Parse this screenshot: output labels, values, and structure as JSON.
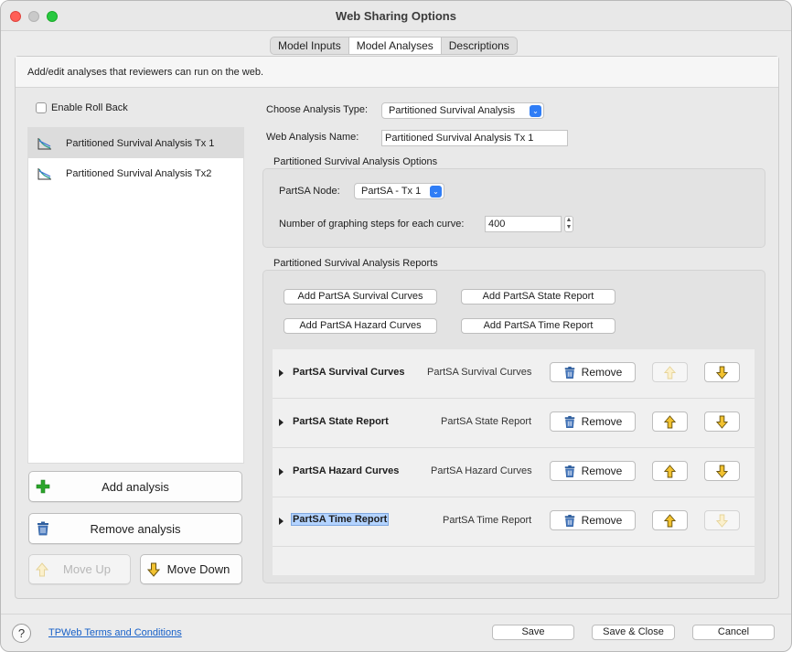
{
  "window": {
    "title": "Web Sharing Options"
  },
  "tabs": [
    {
      "label": "Model Inputs"
    },
    {
      "label": "Model Analyses"
    },
    {
      "label": "Descriptions"
    }
  ],
  "description": "Add/edit analyses that reviewers can run on the web.",
  "left": {
    "enable_rollback_label": "Enable Roll Back",
    "analyses": [
      {
        "label": "Partitioned Survival Analysis Tx 1",
        "icon": "partsa-icon"
      },
      {
        "label": "Partitioned Survival Analysis Tx2",
        "icon": "partsa-icon"
      }
    ],
    "add_label": "Add analysis",
    "remove_label": "Remove analysis",
    "move_up_label": "Move Up",
    "move_down_label": "Move Down"
  },
  "right": {
    "analysis_type_label": "Choose Analysis Type:",
    "analysis_type_value": "Partitioned Survival Analysis",
    "web_name_label": "Web Analysis Name:",
    "web_name_value": "Partitioned Survival Analysis Tx 1",
    "options_title": "Partitioned Survival Analysis Options",
    "node_label": "PartSA Node:",
    "node_value": "PartSA - Tx 1",
    "steps_label": "Number of graphing steps for each curve:",
    "steps_value": "400",
    "reports_title": "Partitioned Survival Analysis Reports",
    "add_buttons": {
      "survival": "Add PartSA Survival Curves",
      "state": "Add PartSA State Report",
      "hazard": "Add PartSA Hazard Curves",
      "time": "Add PartSA Time Report"
    },
    "remove_label": "Remove",
    "reports": [
      {
        "name": "PartSA Survival Curves",
        "type": "PartSA Survival Curves"
      },
      {
        "name": "PartSA State Report",
        "type": "PartSA State Report"
      },
      {
        "name": "PartSA Hazard Curves",
        "type": "PartSA Hazard Curves"
      },
      {
        "name": "PartSA Time Report",
        "type": "PartSA Time Report"
      }
    ]
  },
  "footer": {
    "help": "?",
    "terms_link": "TPWeb Terms and Conditions",
    "save": "Save",
    "save_close": "Save & Close",
    "cancel": "Cancel"
  },
  "colors": {
    "accent": "#2f7df6",
    "link": "#1760c8",
    "add_green": "#2aa52a",
    "trash_blue": "#2f5f9e",
    "arrow_yellow": "#f2c230"
  }
}
